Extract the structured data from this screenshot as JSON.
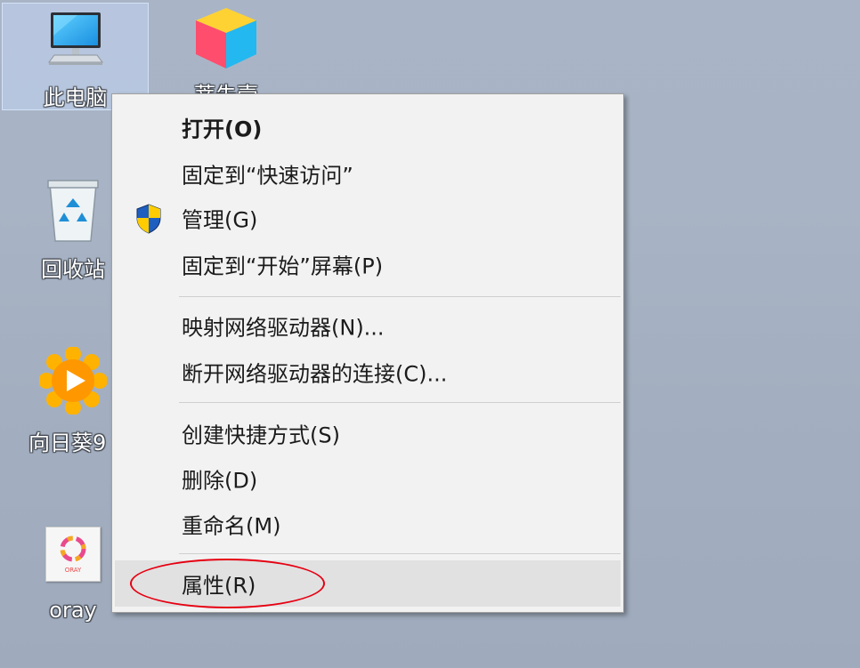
{
  "desktop": {
    "icons": [
      {
        "label": "此电脑"
      },
      {
        "label": "蒂朱壹"
      },
      {
        "label": "回收站"
      },
      {
        "label": "向日葵9"
      },
      {
        "label": "oray"
      }
    ],
    "oray_logo_text": "ORAY"
  },
  "context_menu": {
    "items": [
      {
        "label": "打开(O)"
      },
      {
        "label": "固定到“快速访问”"
      },
      {
        "label": "管理(G)"
      },
      {
        "label": "固定到“开始”屏幕(P)"
      },
      {
        "label": "映射网络驱动器(N)..."
      },
      {
        "label": "断开网络驱动器的连接(C)..."
      },
      {
        "label": "创建快捷方式(S)"
      },
      {
        "label": "删除(D)"
      },
      {
        "label": "重命名(M)"
      },
      {
        "label": "属性(R)"
      }
    ],
    "highlighted_item": "属性(R)"
  },
  "colors": {
    "desktop_bg": "#a8b4c5",
    "menu_bg": "#f2f2f2",
    "highlight_bg": "#e1e1e1",
    "annotation": "#e60012"
  }
}
